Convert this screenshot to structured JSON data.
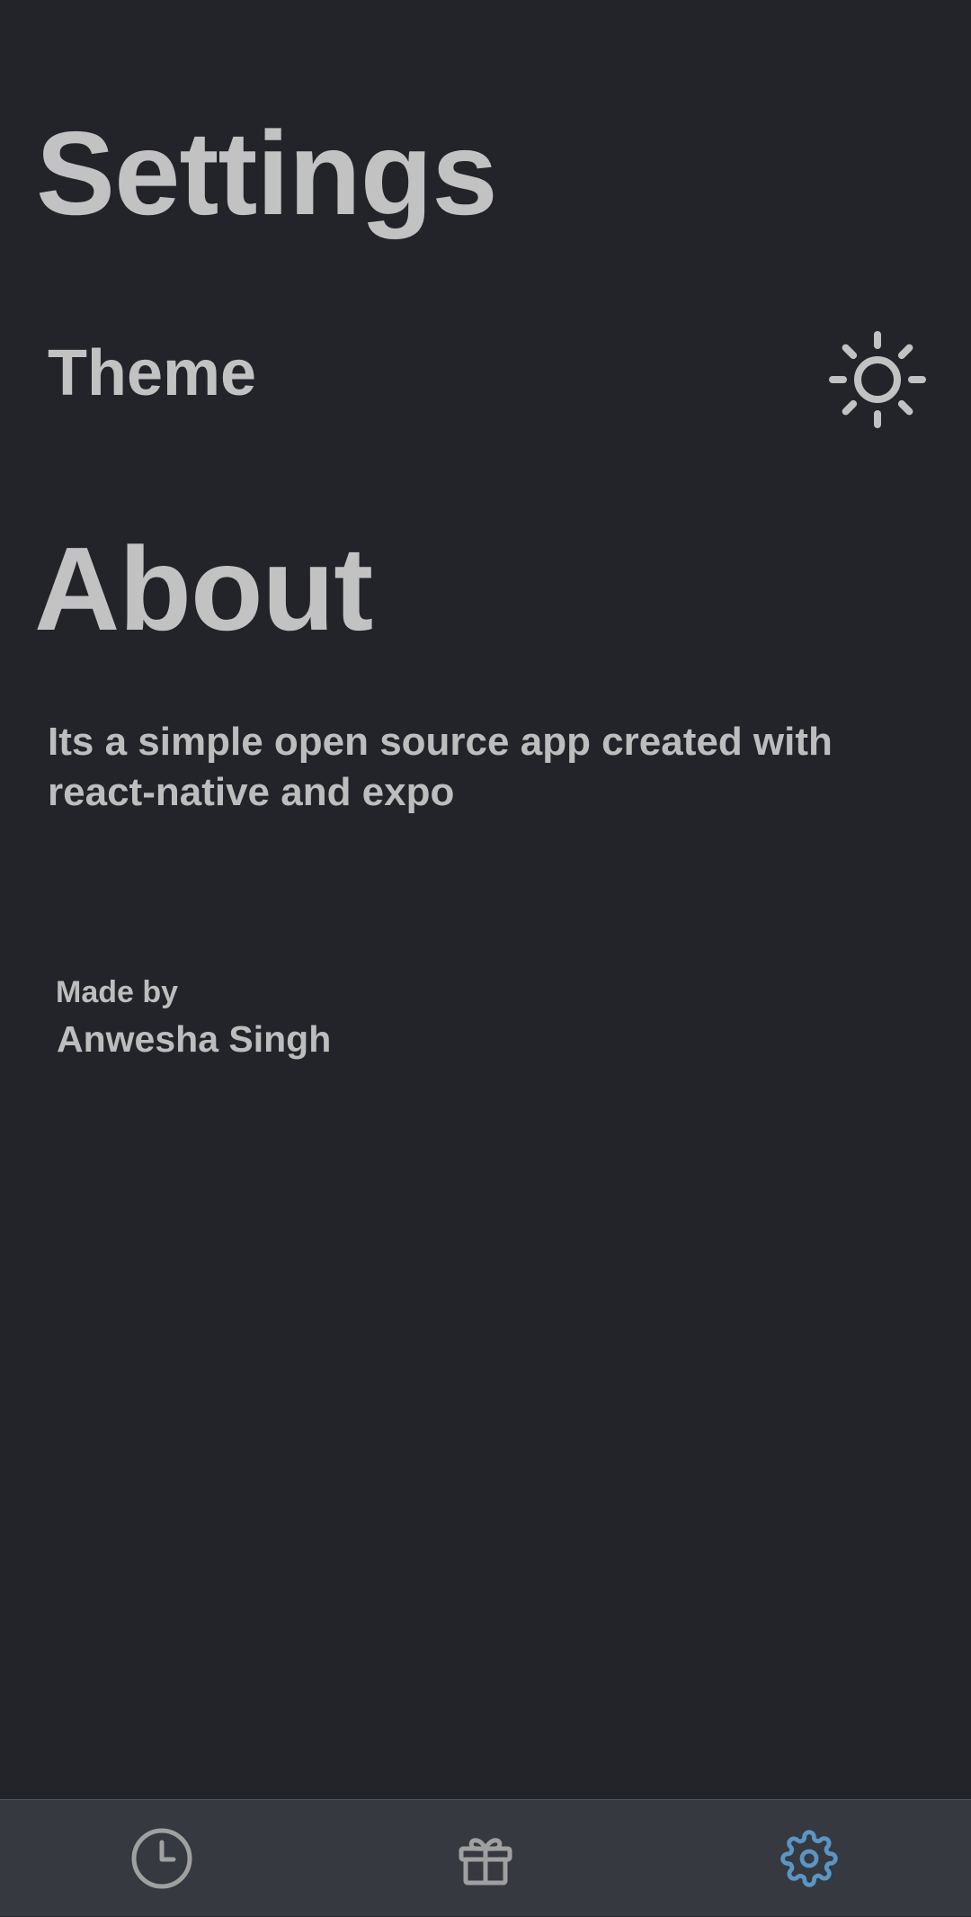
{
  "header": {
    "title": "Settings"
  },
  "theme": {
    "label": "Theme",
    "toggle_icon": "sun-icon"
  },
  "about": {
    "title": "About",
    "description": "Its a simple open source app created with react-native and expo",
    "made_by_label": "Made by",
    "author": "Anwesha Singh"
  },
  "tabbar": {
    "tabs": [
      {
        "icon": "clock-icon",
        "active": false
      },
      {
        "icon": "gift-icon",
        "active": false
      },
      {
        "icon": "gear-icon",
        "active": true
      }
    ]
  },
  "colors": {
    "background": "#222429",
    "tabbar_background": "#363940",
    "text": "#bdbdbd",
    "inactive_icon": "#a0a0a0",
    "active_accent": "#5b95c4"
  }
}
